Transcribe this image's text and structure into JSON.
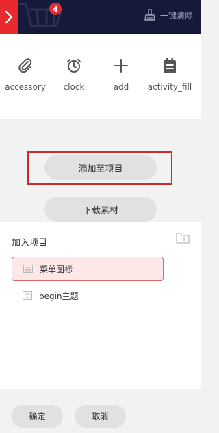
{
  "header": {
    "badge_count": "4",
    "clear_all_label": "一键清除"
  },
  "icons": [
    {
      "label": "accessory",
      "icon": "paperclip-icon"
    },
    {
      "label": "clock",
      "icon": "clock-icon"
    },
    {
      "label": "add",
      "icon": "plus-icon"
    },
    {
      "label": "activity_fill",
      "icon": "calendar-icon"
    }
  ],
  "actions": {
    "add_to_project_label": "添加至项目",
    "download_label": "下载素材"
  },
  "project": {
    "title": "加入项目",
    "items": [
      {
        "label": "菜单图标",
        "selected": true
      },
      {
        "label": "begin主题",
        "selected": false
      }
    ]
  },
  "footer": {
    "confirm_label": "确定",
    "cancel_label": "取消"
  },
  "colors": {
    "topbar": "#15193a",
    "accent_red": "#e8292e"
  }
}
